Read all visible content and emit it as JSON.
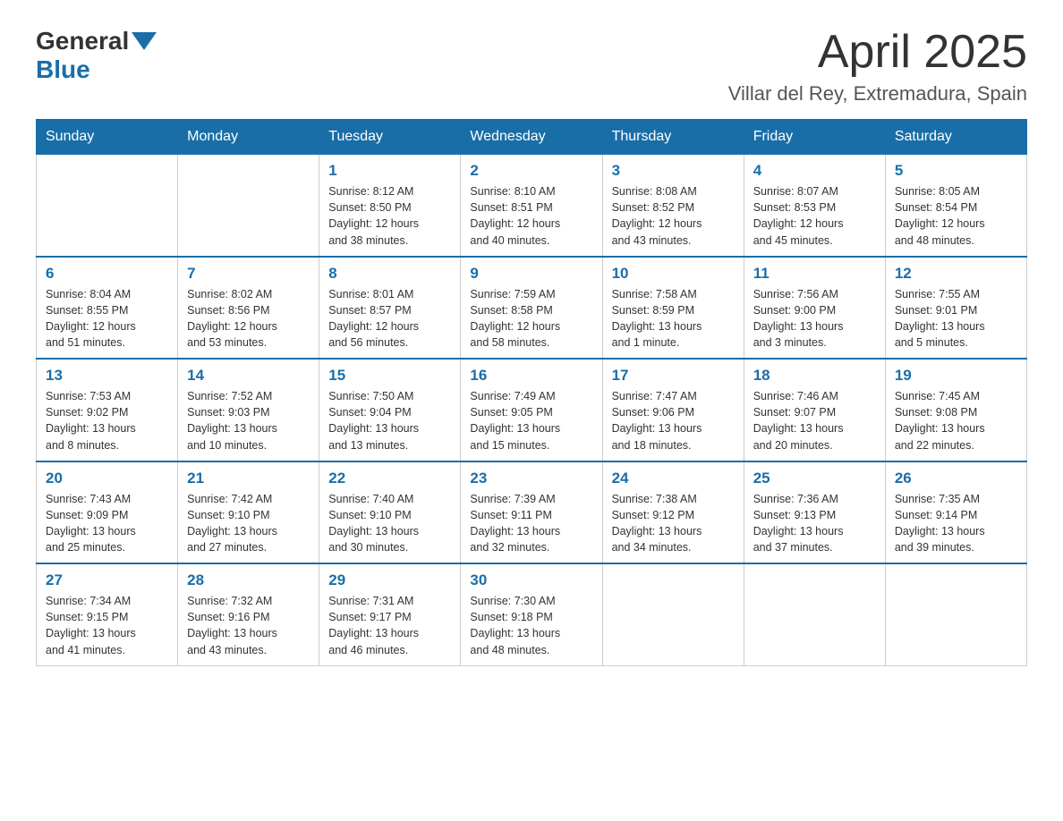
{
  "header": {
    "logo_general": "General",
    "logo_blue": "Blue",
    "month_title": "April 2025",
    "location": "Villar del Rey, Extremadura, Spain"
  },
  "weekdays": [
    "Sunday",
    "Monday",
    "Tuesday",
    "Wednesday",
    "Thursday",
    "Friday",
    "Saturday"
  ],
  "weeks": [
    [
      {
        "day": "",
        "info": ""
      },
      {
        "day": "",
        "info": ""
      },
      {
        "day": "1",
        "info": "Sunrise: 8:12 AM\nSunset: 8:50 PM\nDaylight: 12 hours\nand 38 minutes."
      },
      {
        "day": "2",
        "info": "Sunrise: 8:10 AM\nSunset: 8:51 PM\nDaylight: 12 hours\nand 40 minutes."
      },
      {
        "day": "3",
        "info": "Sunrise: 8:08 AM\nSunset: 8:52 PM\nDaylight: 12 hours\nand 43 minutes."
      },
      {
        "day": "4",
        "info": "Sunrise: 8:07 AM\nSunset: 8:53 PM\nDaylight: 12 hours\nand 45 minutes."
      },
      {
        "day": "5",
        "info": "Sunrise: 8:05 AM\nSunset: 8:54 PM\nDaylight: 12 hours\nand 48 minutes."
      }
    ],
    [
      {
        "day": "6",
        "info": "Sunrise: 8:04 AM\nSunset: 8:55 PM\nDaylight: 12 hours\nand 51 minutes."
      },
      {
        "day": "7",
        "info": "Sunrise: 8:02 AM\nSunset: 8:56 PM\nDaylight: 12 hours\nand 53 minutes."
      },
      {
        "day": "8",
        "info": "Sunrise: 8:01 AM\nSunset: 8:57 PM\nDaylight: 12 hours\nand 56 minutes."
      },
      {
        "day": "9",
        "info": "Sunrise: 7:59 AM\nSunset: 8:58 PM\nDaylight: 12 hours\nand 58 minutes."
      },
      {
        "day": "10",
        "info": "Sunrise: 7:58 AM\nSunset: 8:59 PM\nDaylight: 13 hours\nand 1 minute."
      },
      {
        "day": "11",
        "info": "Sunrise: 7:56 AM\nSunset: 9:00 PM\nDaylight: 13 hours\nand 3 minutes."
      },
      {
        "day": "12",
        "info": "Sunrise: 7:55 AM\nSunset: 9:01 PM\nDaylight: 13 hours\nand 5 minutes."
      }
    ],
    [
      {
        "day": "13",
        "info": "Sunrise: 7:53 AM\nSunset: 9:02 PM\nDaylight: 13 hours\nand 8 minutes."
      },
      {
        "day": "14",
        "info": "Sunrise: 7:52 AM\nSunset: 9:03 PM\nDaylight: 13 hours\nand 10 minutes."
      },
      {
        "day": "15",
        "info": "Sunrise: 7:50 AM\nSunset: 9:04 PM\nDaylight: 13 hours\nand 13 minutes."
      },
      {
        "day": "16",
        "info": "Sunrise: 7:49 AM\nSunset: 9:05 PM\nDaylight: 13 hours\nand 15 minutes."
      },
      {
        "day": "17",
        "info": "Sunrise: 7:47 AM\nSunset: 9:06 PM\nDaylight: 13 hours\nand 18 minutes."
      },
      {
        "day": "18",
        "info": "Sunrise: 7:46 AM\nSunset: 9:07 PM\nDaylight: 13 hours\nand 20 minutes."
      },
      {
        "day": "19",
        "info": "Sunrise: 7:45 AM\nSunset: 9:08 PM\nDaylight: 13 hours\nand 22 minutes."
      }
    ],
    [
      {
        "day": "20",
        "info": "Sunrise: 7:43 AM\nSunset: 9:09 PM\nDaylight: 13 hours\nand 25 minutes."
      },
      {
        "day": "21",
        "info": "Sunrise: 7:42 AM\nSunset: 9:10 PM\nDaylight: 13 hours\nand 27 minutes."
      },
      {
        "day": "22",
        "info": "Sunrise: 7:40 AM\nSunset: 9:10 PM\nDaylight: 13 hours\nand 30 minutes."
      },
      {
        "day": "23",
        "info": "Sunrise: 7:39 AM\nSunset: 9:11 PM\nDaylight: 13 hours\nand 32 minutes."
      },
      {
        "day": "24",
        "info": "Sunrise: 7:38 AM\nSunset: 9:12 PM\nDaylight: 13 hours\nand 34 minutes."
      },
      {
        "day": "25",
        "info": "Sunrise: 7:36 AM\nSunset: 9:13 PM\nDaylight: 13 hours\nand 37 minutes."
      },
      {
        "day": "26",
        "info": "Sunrise: 7:35 AM\nSunset: 9:14 PM\nDaylight: 13 hours\nand 39 minutes."
      }
    ],
    [
      {
        "day": "27",
        "info": "Sunrise: 7:34 AM\nSunset: 9:15 PM\nDaylight: 13 hours\nand 41 minutes."
      },
      {
        "day": "28",
        "info": "Sunrise: 7:32 AM\nSunset: 9:16 PM\nDaylight: 13 hours\nand 43 minutes."
      },
      {
        "day": "29",
        "info": "Sunrise: 7:31 AM\nSunset: 9:17 PM\nDaylight: 13 hours\nand 46 minutes."
      },
      {
        "day": "30",
        "info": "Sunrise: 7:30 AM\nSunset: 9:18 PM\nDaylight: 13 hours\nand 48 minutes."
      },
      {
        "day": "",
        "info": ""
      },
      {
        "day": "",
        "info": ""
      },
      {
        "day": "",
        "info": ""
      }
    ]
  ]
}
